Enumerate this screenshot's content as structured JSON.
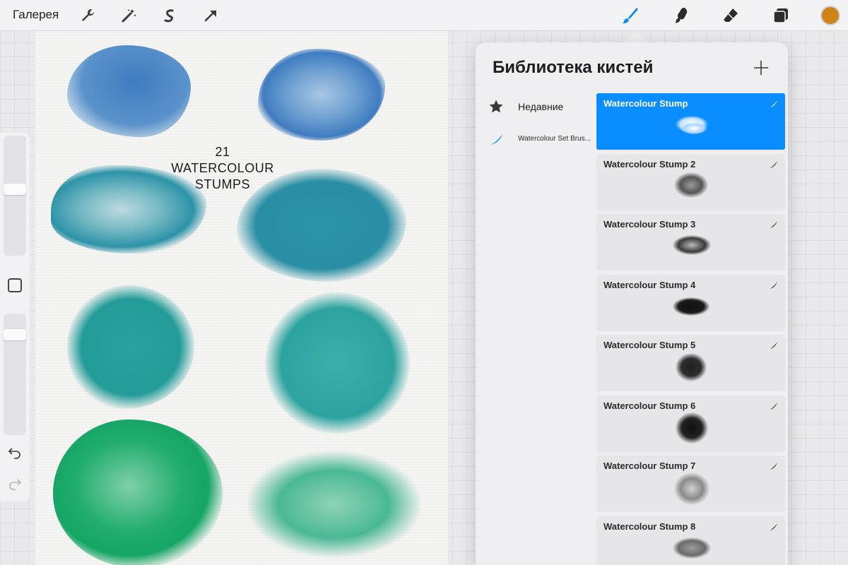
{
  "toolbar": {
    "gallery_label": "Галерея",
    "color_swatch": "#cf8418"
  },
  "canvas": {
    "title_line1": "21 WATERCOLOUR",
    "title_line2": "STUMPS"
  },
  "brush_library": {
    "title": "Библиотека кистей",
    "sets": [
      {
        "label": "Недавние",
        "icon": "star-icon"
      },
      {
        "label": "Watercolour Set Brus...",
        "icon": "brush-stroke-icon"
      }
    ],
    "brushes": [
      {
        "name": "Watercolour Stump",
        "selected": true
      },
      {
        "name": "Watercolour Stump 2",
        "selected": false
      },
      {
        "name": "Watercolour Stump 3",
        "selected": false
      },
      {
        "name": "Watercolour Stump 4",
        "selected": false
      },
      {
        "name": "Watercolour Stump 5",
        "selected": false
      },
      {
        "name": "Watercolour Stump 6",
        "selected": false
      },
      {
        "name": "Watercolour Stump 7",
        "selected": false
      },
      {
        "name": "Watercolour Stump 8",
        "selected": false
      }
    ]
  },
  "colors": {
    "accent": "#0a8dff",
    "blue_stain": "#4a86c2",
    "teal_stain": "#2b93a8",
    "turquoise_stain": "#2aa3a0",
    "green_stain": "#18a869",
    "mint_stain": "#4ab894"
  }
}
